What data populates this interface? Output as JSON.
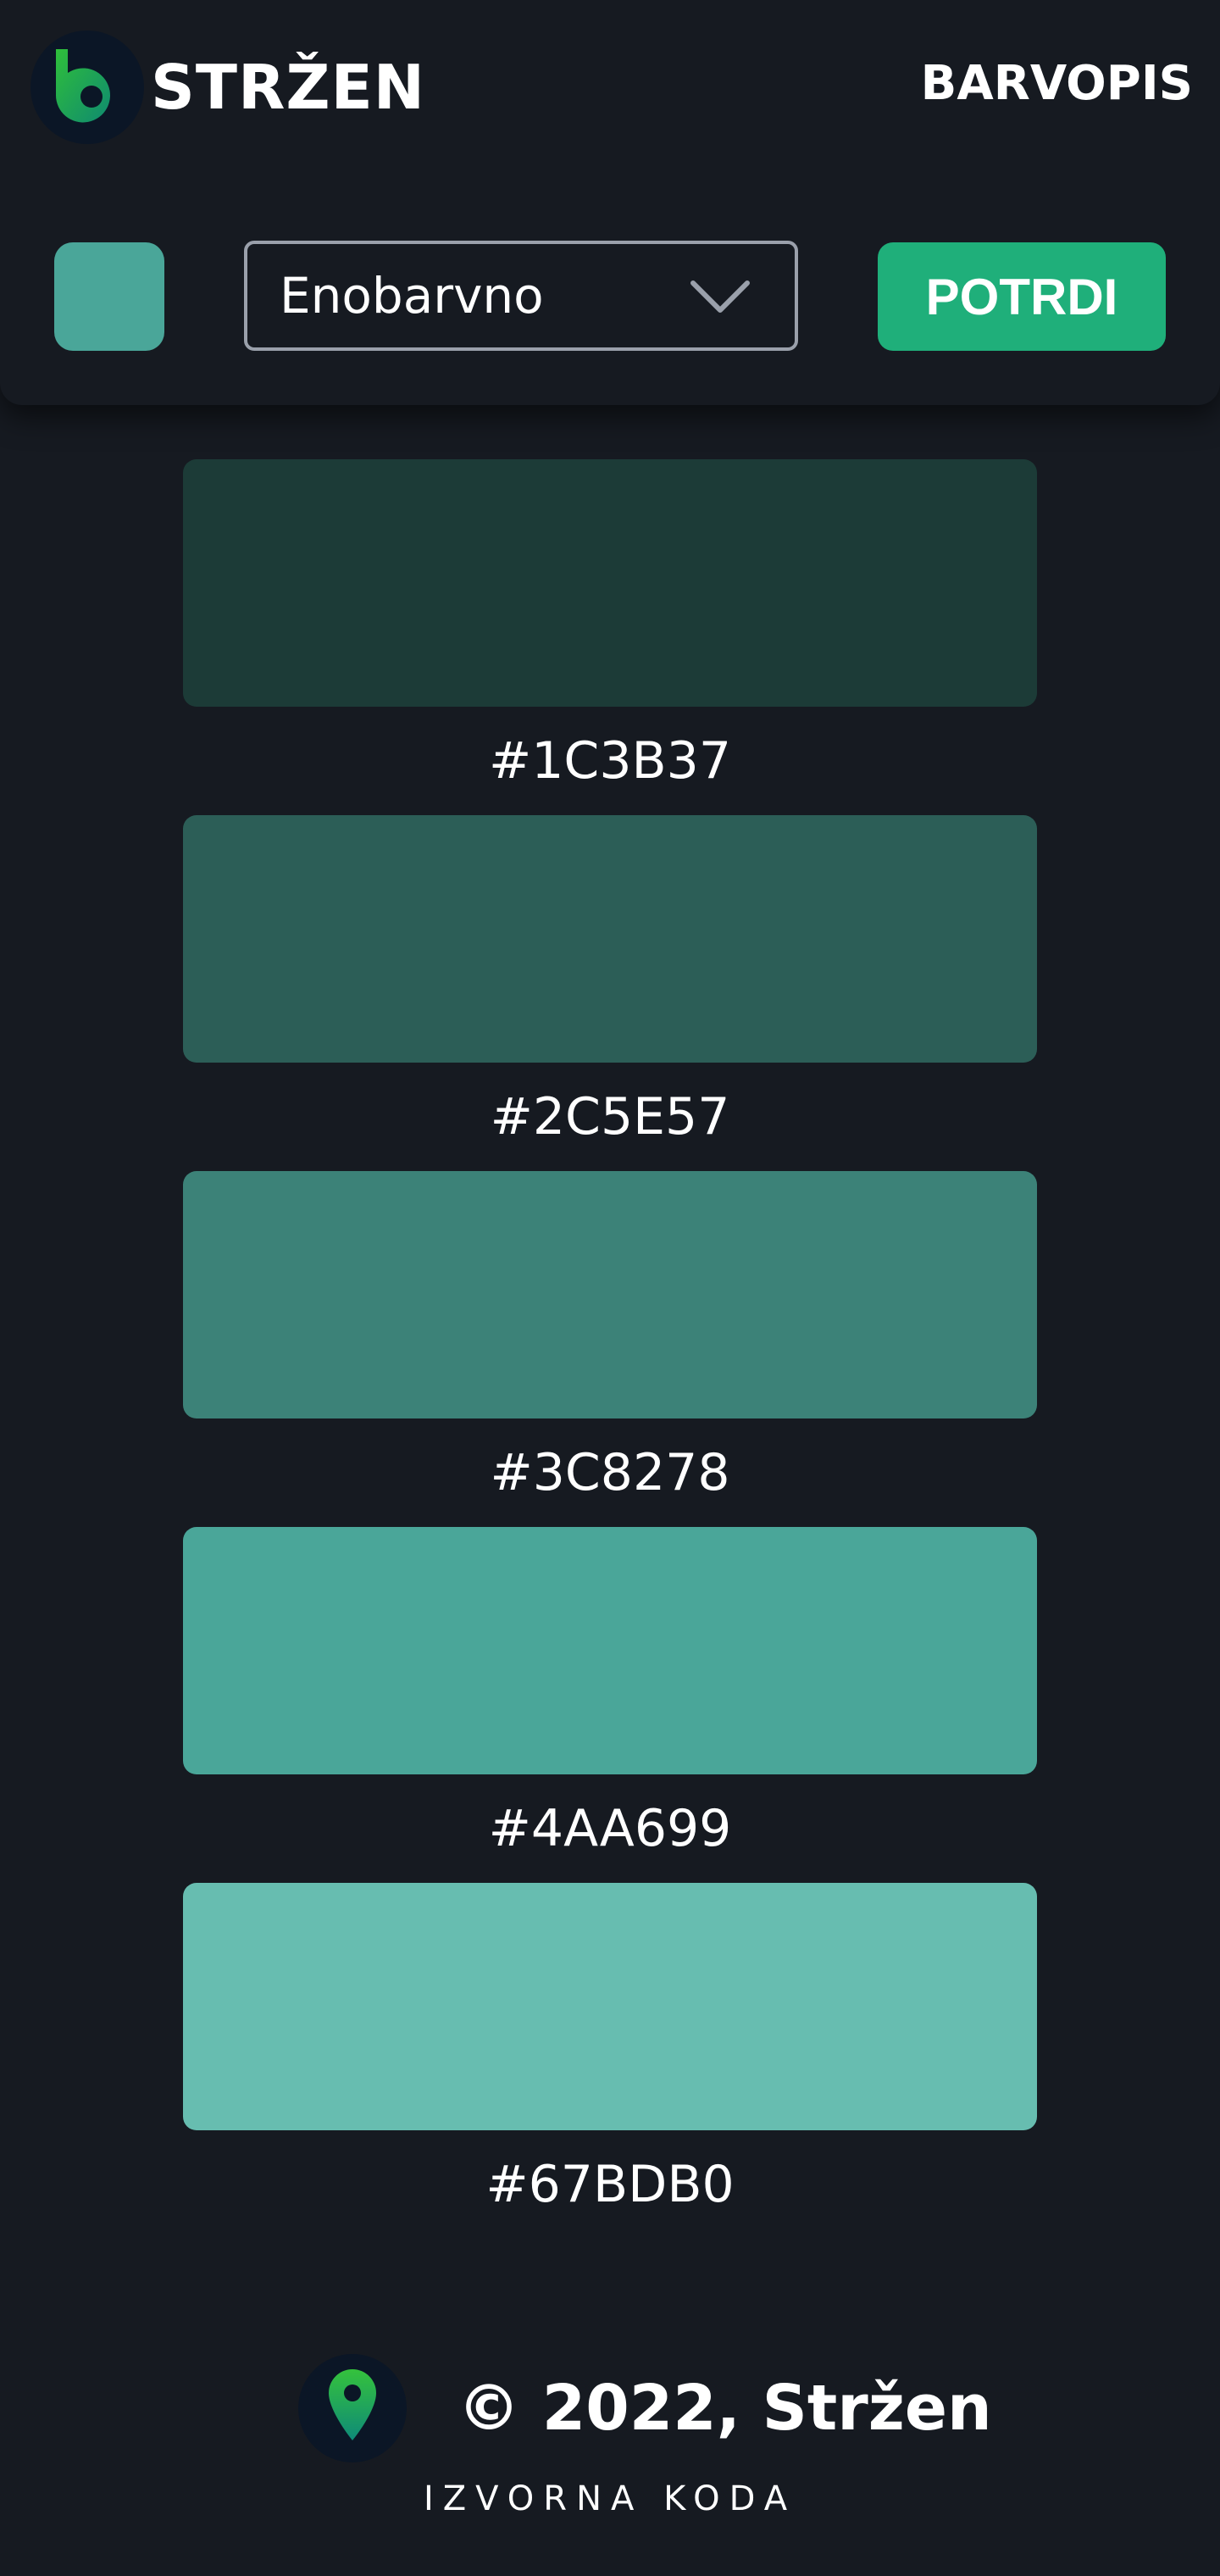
{
  "header": {
    "brand": "STRŽEN",
    "nav_link": "BARVOPIS"
  },
  "controls": {
    "selected_color": "#4AA699",
    "mode_value": "Enobarvno",
    "confirm_label": "POTRDI"
  },
  "palette": [
    {
      "color": "#1C3B37",
      "label": "#1C3B37"
    },
    {
      "color": "#2C5E57",
      "label": "#2C5E57"
    },
    {
      "color": "#3C8278",
      "label": "#3C8278"
    },
    {
      "color": "#4AA699",
      "label": "#4AA699"
    },
    {
      "color": "#67BDB0",
      "label": "#67BDB0"
    }
  ],
  "footer": {
    "copyright": "© 2022, Stržen",
    "source_link": "IZVORNA KODA"
  },
  "theme": {
    "background": "#161A21",
    "accent": "#1FAF7A",
    "select_border": "#9AA0AB"
  },
  "icons": {
    "logo": "stren-logo-icon",
    "dropdown": "chevron-down-icon",
    "footer": "map-pin-icon"
  }
}
